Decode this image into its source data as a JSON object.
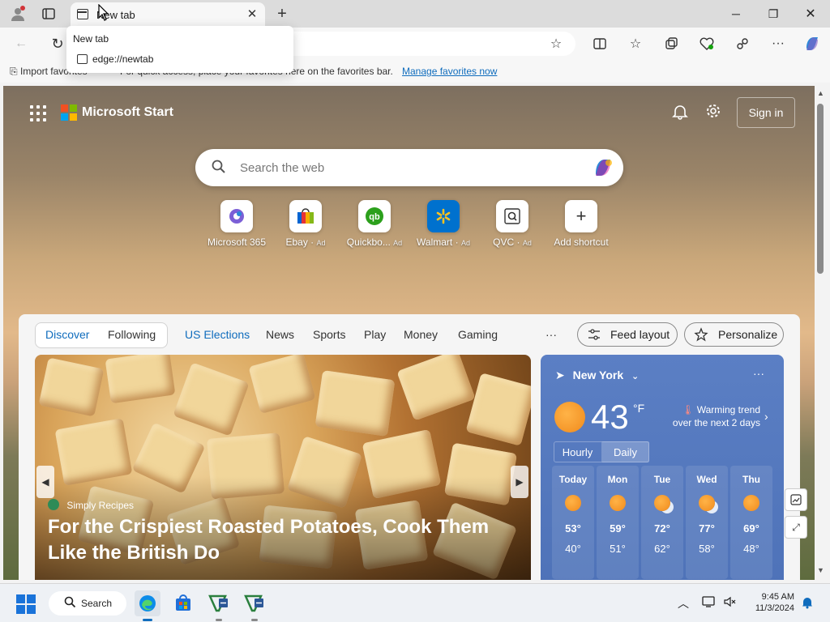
{
  "browser": {
    "tab_title": "New tab",
    "tab_popup": {
      "title": "New tab",
      "url": "edge://newtab"
    },
    "favorites_bar": {
      "import": "Import favorites",
      "message": "For quick access, place your favorites here on the favorites bar.",
      "manage_link": "Manage favorites now"
    }
  },
  "page": {
    "brand": "Microsoft Start",
    "sign_in": "Sign in",
    "search_placeholder": "Search the web",
    "shortcuts": [
      {
        "label": "Microsoft 365",
        "ad": ""
      },
      {
        "label": "Ebay",
        "ad": "Ad"
      },
      {
        "label": "Quickbo...",
        "ad": "Ad"
      },
      {
        "label": "Walmart",
        "ad": "Ad"
      },
      {
        "label": "QVC",
        "ad": "Ad"
      },
      {
        "label": "Add shortcut",
        "ad": ""
      }
    ],
    "feed_tabs": {
      "discover": "Discover",
      "following": "Following",
      "items": [
        "US Elections",
        "News",
        "Sports",
        "Play",
        "Money",
        "Gaming"
      ],
      "more": "···",
      "feed_layout": "Feed layout",
      "personalize": "Personalize"
    },
    "hero": {
      "source": "Simply Recipes",
      "title": "For the Crispiest Roasted Potatoes, Cook Them Like the British Do"
    },
    "weather": {
      "location": "New York",
      "more": "···",
      "temp": "43",
      "unit": "°F",
      "trend_line1": "Warming trend",
      "trend_line2": "over the next 2 days",
      "hourly": "Hourly",
      "daily": "Daily",
      "days": [
        {
          "name": "Today",
          "hi": "53°",
          "lo": "40°"
        },
        {
          "name": "Mon",
          "hi": "59°",
          "lo": "51°"
        },
        {
          "name": "Tue",
          "hi": "72°",
          "lo": "62°"
        },
        {
          "name": "Wed",
          "hi": "77°",
          "lo": "58°"
        },
        {
          "name": "Thu",
          "hi": "69°",
          "lo": "48°"
        }
      ]
    }
  },
  "taskbar": {
    "search": "Search",
    "time": "9:45 AM",
    "date": "11/3/2024"
  },
  "colors": {
    "accent": "#0f6cbd",
    "weather_bg": "#5b7fc4",
    "windows_blue": "#1a73d9"
  }
}
